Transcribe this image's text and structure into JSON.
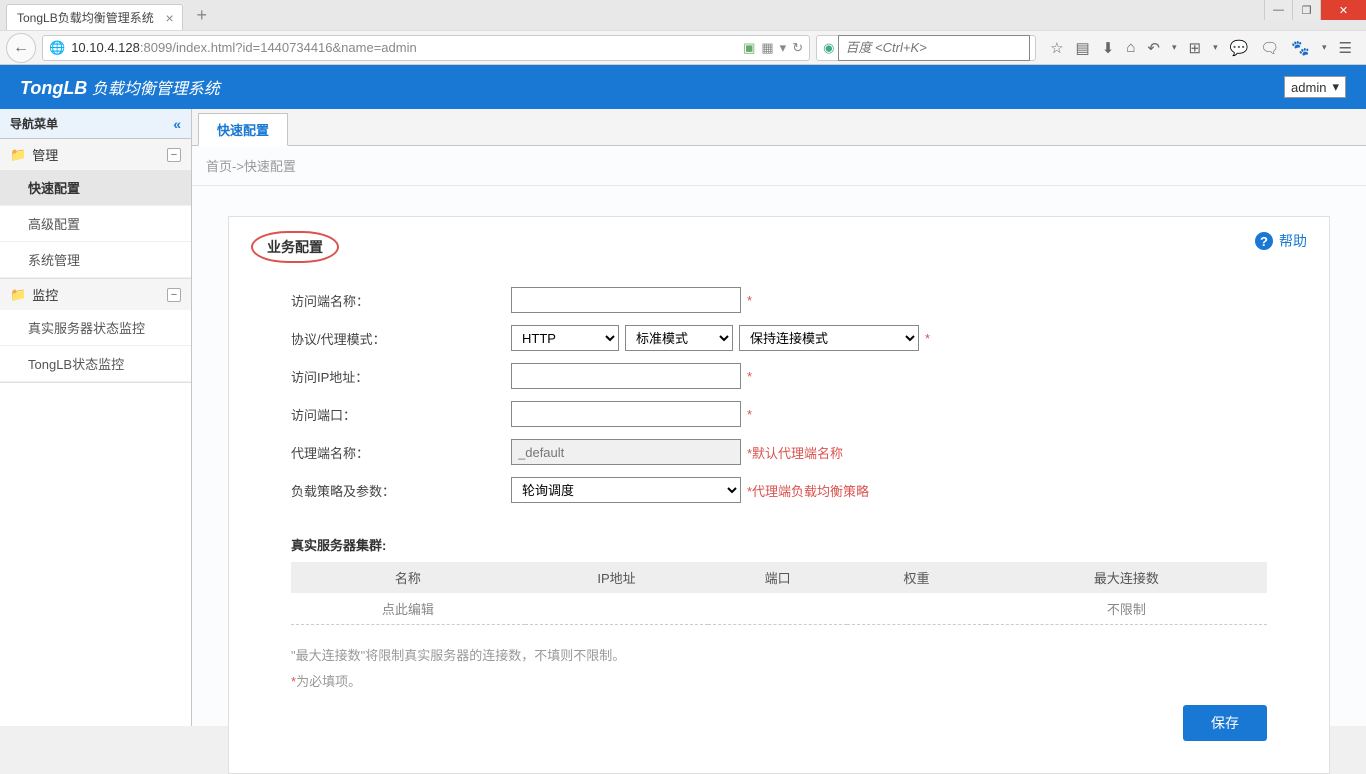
{
  "browser": {
    "tab_title": "TongLB负载均衡管理系统",
    "url_host": "10.10.4.128",
    "url_path": ":8099/index.html?id=1440734416&name=admin",
    "search_placeholder": "百度 <Ctrl+K>"
  },
  "header": {
    "logo_prefix": "TongLB",
    "logo_suffix": " 负载均衡管理系统",
    "user": "admin"
  },
  "sidebar": {
    "title": "导航菜单",
    "groups": [
      {
        "label": "管理",
        "items": [
          "快速配置",
          "高级配置",
          "系统管理"
        ],
        "active_item": "快速配置"
      },
      {
        "label": "监控",
        "items": [
          "真实服务器状态监控",
          "TongLB状态监控"
        ]
      }
    ]
  },
  "content": {
    "tab": "快速配置",
    "breadcrumb": "首页->快速配置",
    "section_title": "业务配置",
    "help_label": "帮助",
    "form": {
      "access_name": {
        "label": "访问端名称：",
        "value": ""
      },
      "protocol": {
        "label": "协议/代理模式：",
        "sel1": "HTTP",
        "sel2": "标准模式",
        "sel3": "保持连接模式"
      },
      "access_ip": {
        "label": "访问IP地址：",
        "value": ""
      },
      "access_port": {
        "label": "访问端口：",
        "value": ""
      },
      "proxy_name": {
        "label": "代理端名称：",
        "value": "_default",
        "hint": "*默认代理端名称"
      },
      "lb_policy": {
        "label": "负载策略及参数：",
        "sel": "轮询调度",
        "hint": "*代理端负载均衡策略"
      }
    },
    "cluster": {
      "title": "真实服务器集群:",
      "headers": [
        "名称",
        "IP地址",
        "端口",
        "权重",
        "最大连接数"
      ],
      "row_placeholder": "点此编辑",
      "row_maxconn": "不限制"
    },
    "note1": "\"最大连接数\"将限制真实服务器的连接数，不填则不限制。",
    "note2_prefix": "*",
    "note2_text": "为必填项。",
    "save_btn": "保存"
  }
}
